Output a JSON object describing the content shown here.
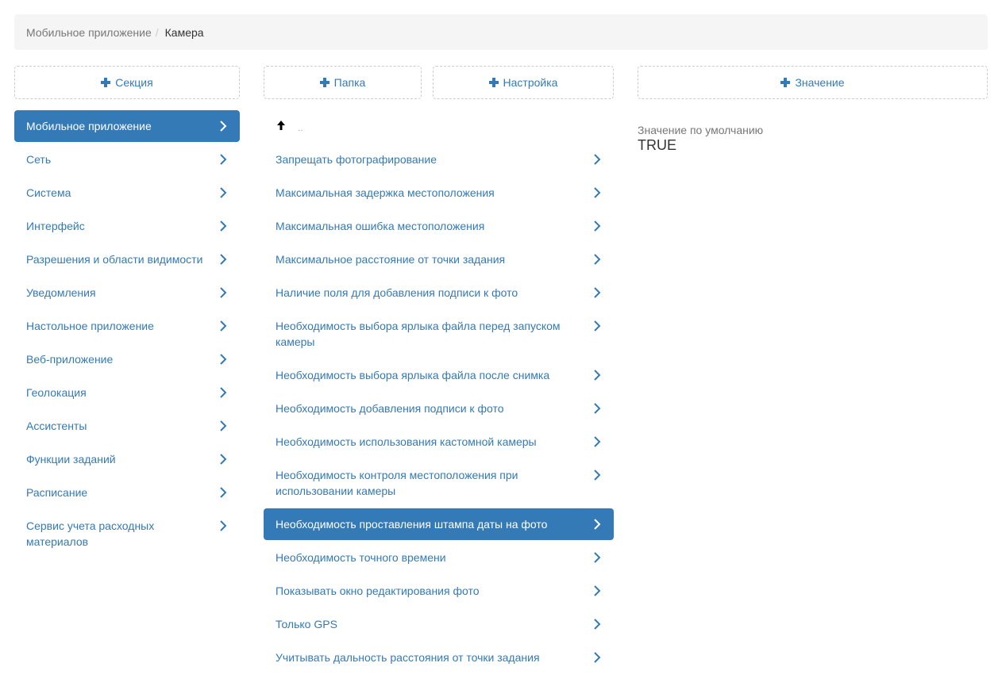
{
  "breadcrumb": {
    "parent": "Мобильное приложение",
    "separator": "/",
    "current": "Камера"
  },
  "buttons": {
    "section": "Секция",
    "folder": "Папка",
    "setting": "Настройка",
    "value": "Значение"
  },
  "sections": [
    {
      "label": "Мобильное приложение",
      "active": true
    },
    {
      "label": "Сеть"
    },
    {
      "label": "Система"
    },
    {
      "label": "Интерфейс"
    },
    {
      "label": "Разрешения и области видимости"
    },
    {
      "label": "Уведомления"
    },
    {
      "label": "Настольное приложение"
    },
    {
      "label": "Веб-приложение"
    },
    {
      "label": "Геолокация"
    },
    {
      "label": "Ассистенты"
    },
    {
      "label": "Функции заданий"
    },
    {
      "label": "Расписание"
    },
    {
      "label": "Сервис учета расходных материалов"
    }
  ],
  "folder_up": {
    "label": ".."
  },
  "settings": [
    {
      "label": "Запрещать фотографирование"
    },
    {
      "label": "Максимальная задержка местоположения"
    },
    {
      "label": "Максимальная ошибка местоположения"
    },
    {
      "label": "Максимальное расстояние от точки задания"
    },
    {
      "label": "Наличие поля для добавления подписи к фото"
    },
    {
      "label": "Необходимость выбора ярлыка файла перед запуском камеры"
    },
    {
      "label": "Необходимость выбора ярлыка файла после снимка"
    },
    {
      "label": "Необходимость добавления подписи к фото"
    },
    {
      "label": "Необходимость использования кастомной камеры"
    },
    {
      "label": "Необходимость контроля местоположения при использовании камеры"
    },
    {
      "label": "Необходимость проставления штампа даты на фото",
      "active": true
    },
    {
      "label": "Необходимость точного времени"
    },
    {
      "label": "Показывать окно редактирования фото"
    },
    {
      "label": "Только GPS"
    },
    {
      "label": "Учитывать дальность расстояния от точки задания"
    }
  ],
  "value_panel": {
    "label": "Значение по умолчанию",
    "value": "TRUE"
  },
  "colors": {
    "accent": "#337ab7",
    "breadcrumb_bg": "#f5f5f5"
  },
  "icons": {
    "add": "plus-icon",
    "item": "chevron-right-icon",
    "up": "arrow-up-icon"
  }
}
